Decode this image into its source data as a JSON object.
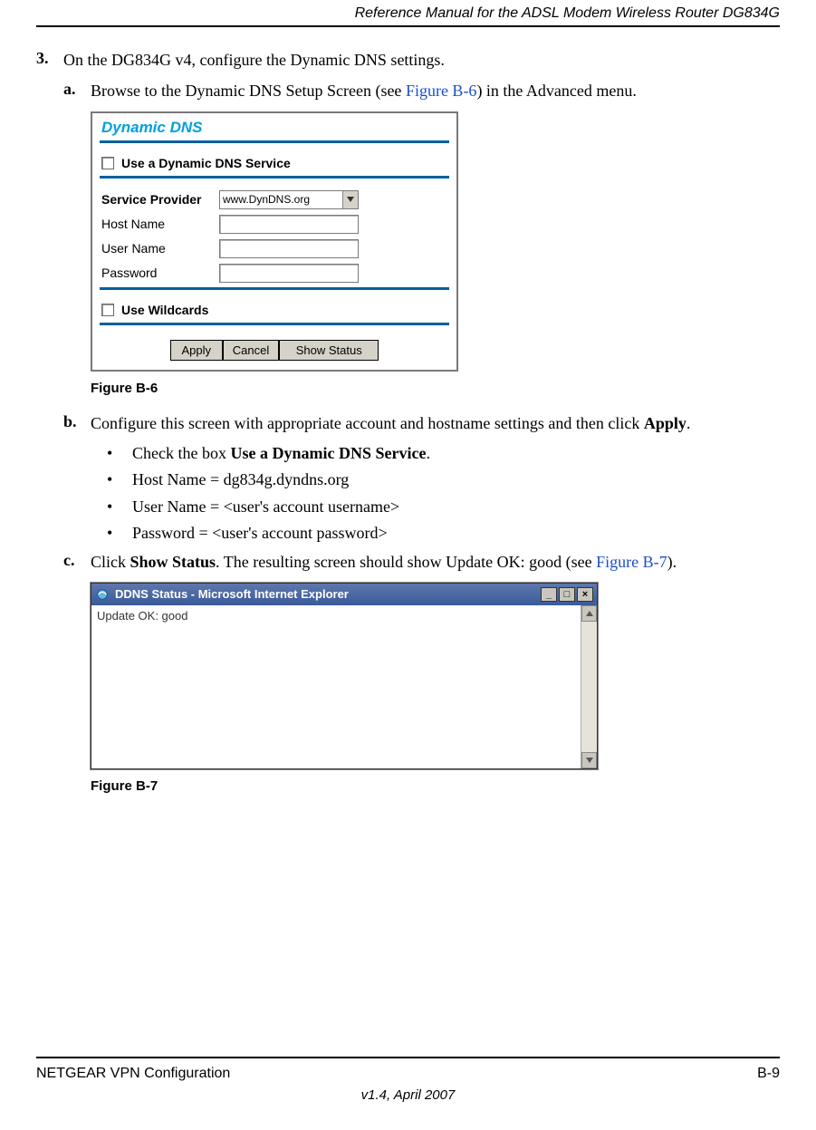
{
  "header": {
    "title": "Reference Manual for the ADSL Modem Wireless Router DG834G"
  },
  "body": {
    "step3": {
      "num": "3.",
      "text": "On the DG834G v4, configure the Dynamic DNS settings."
    },
    "sub_a": {
      "letter": "a.",
      "text_pre": "Browse to the Dynamic DNS Setup Screen (see ",
      "link": "Figure B-6",
      "text_post": ") in the Advanced menu."
    },
    "figB6": {
      "title": "Dynamic DNS",
      "use_ddns_label": "Use a Dynamic DNS Service",
      "provider_label": "Service Provider",
      "provider_value": "www.DynDNS.org",
      "host_label": "Host Name",
      "user_label": "User Name",
      "pass_label": "Password",
      "wildcards_label": "Use Wildcards",
      "btn_apply": "Apply",
      "btn_cancel": "Cancel",
      "btn_status": "Show Status",
      "caption": "Figure B-6"
    },
    "sub_b": {
      "letter": "b.",
      "text_pre": "Configure this screen with appropriate account and hostname settings and then click ",
      "bold": "Apply",
      "text_post": "."
    },
    "bullets": {
      "b1_pre": "Check the box ",
      "b1_bold": "Use a Dynamic DNS Service",
      "b1_post": ".",
      "b2": "Host Name = dg834g.dyndns.org",
      "b3": "User Name = <user's account username>",
      "b4": "Password = <user's account password>"
    },
    "sub_c": {
      "letter": "c.",
      "text_1": "Click ",
      "bold": "Show Status",
      "text_2": ". The resulting screen should show Update OK: good (see ",
      "link": "Figure B-7",
      "text_3": ")."
    },
    "figB7": {
      "title": "DDNS Status - Microsoft Internet Explorer",
      "content": "Update OK: good",
      "caption": "Figure B-7"
    }
  },
  "footer": {
    "left": "NETGEAR VPN Configuration",
    "right": "B-9",
    "version": "v1.4, April 2007"
  }
}
